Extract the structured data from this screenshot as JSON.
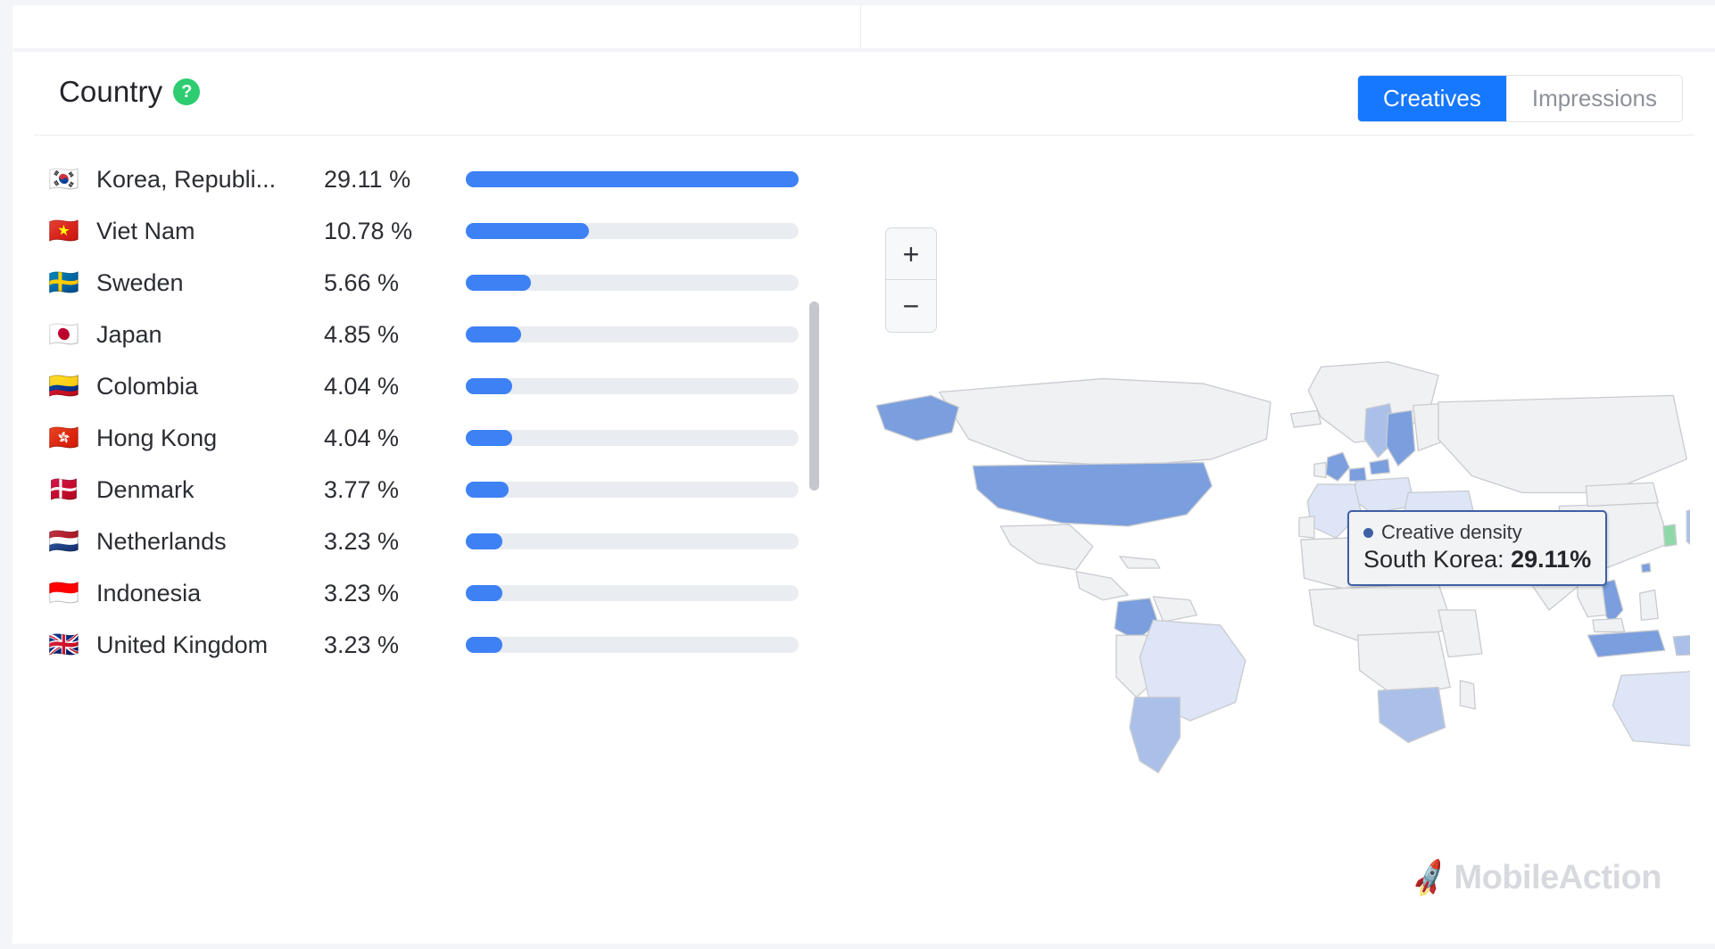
{
  "header": {
    "title": "Country",
    "help_icon": "question-mark-icon",
    "toggle": {
      "options": [
        {
          "label": "Creatives",
          "active": true
        },
        {
          "label": "Impressions",
          "active": false
        }
      ]
    }
  },
  "map": {
    "zoom_in_label": "+",
    "zoom_out_label": "−",
    "tooltip": {
      "series_label": "Creative density",
      "value_line": "South Korea: ",
      "value": "29.11%"
    },
    "colors": {
      "land": "#f0f1f3",
      "border": "#c9cbd0",
      "highlight_max": "#7a9ede",
      "highlight_mid": "#aac0e8",
      "highlight_low": "#dde5f6",
      "hovered": "#8fd9a8"
    }
  },
  "watermark": {
    "text": "MobileAction",
    "icon": "rocket-icon"
  },
  "chart_data": {
    "type": "bar",
    "title": "Country",
    "xlabel": "",
    "ylabel": "",
    "metric": "Creatives",
    "unit": "%",
    "max_value": 29.11,
    "categories": [
      "Korea, Republi...",
      "Viet Nam",
      "Sweden",
      "Japan",
      "Colombia",
      "Hong Kong",
      "Denmark",
      "Netherlands",
      "Indonesia",
      "United Kingdom"
    ],
    "values": [
      29.11,
      10.78,
      5.66,
      4.85,
      4.04,
      4.04,
      3.77,
      3.23,
      3.23,
      3.23
    ],
    "rows": [
      {
        "flag": "🇰🇷",
        "country": "Korea, Republi...",
        "percent": "29.11 %",
        "value": 29.11
      },
      {
        "flag": "🇻🇳",
        "country": "Viet Nam",
        "percent": "10.78 %",
        "value": 10.78
      },
      {
        "flag": "🇸🇪",
        "country": "Sweden",
        "percent": "5.66 %",
        "value": 5.66
      },
      {
        "flag": "🇯🇵",
        "country": "Japan",
        "percent": "4.85 %",
        "value": 4.85
      },
      {
        "flag": "🇨🇴",
        "country": "Colombia",
        "percent": "4.04 %",
        "value": 4.04
      },
      {
        "flag": "🇭🇰",
        "country": "Hong Kong",
        "percent": "4.04 %",
        "value": 4.04
      },
      {
        "flag": "🇩🇰",
        "country": "Denmark",
        "percent": "3.77 %",
        "value": 3.77
      },
      {
        "flag": "🇳🇱",
        "country": "Netherlands",
        "percent": "3.23 %",
        "value": 3.23
      },
      {
        "flag": "🇮🇩",
        "country": "Indonesia",
        "percent": "3.23 %",
        "value": 3.23
      },
      {
        "flag": "🇬🇧",
        "country": "United Kingdom",
        "percent": "3.23 %",
        "value": 3.23
      }
    ]
  }
}
